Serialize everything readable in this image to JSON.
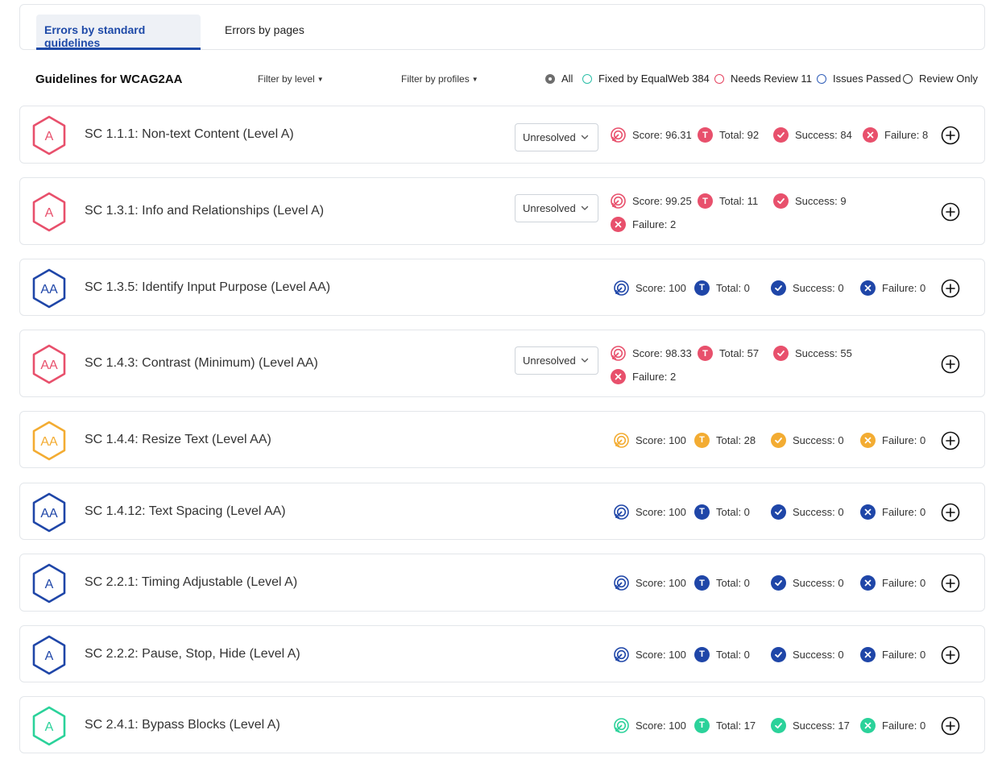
{
  "tabs": [
    {
      "label": "Errors by standard guidelines",
      "active": true
    },
    {
      "label": "Errors by pages",
      "active": false
    }
  ],
  "toolbar": {
    "title": "Guidelines for WCAG2AA",
    "filter_level": "Filter by level",
    "filter_profiles": "Filter by profiles",
    "radios": [
      {
        "label": "All",
        "selected": true,
        "color": "#555555"
      },
      {
        "label": "Fixed by EqualWeb 384",
        "selected": false,
        "color": "#2bbfa8"
      },
      {
        "label": "Needs Review 11",
        "selected": false,
        "color": "#e5425f"
      },
      {
        "label": "Issues Passed",
        "selected": false,
        "color": "#2f5db8"
      },
      {
        "label": "Review Only",
        "selected": false,
        "color": "#333333"
      }
    ]
  },
  "colors": {
    "red": "#e8506c",
    "blue": "#1f46a8",
    "orange": "#f3ac32",
    "green": "#2bd29a"
  },
  "guidelines": [
    {
      "level_badge": "A",
      "color": "red",
      "title": "SC 1.1.1: Non-text Content (Level A)",
      "status": "Unresolved",
      "score": "Score: 96.31",
      "total": "Total: 92",
      "success": "Success: 84",
      "failure": "Failure: 8"
    },
    {
      "level_badge": "A",
      "color": "red",
      "title": "SC 1.3.1: Info and Relationships (Level A)",
      "status": "Unresolved",
      "score": "Score: 99.25",
      "total": "Total: 11",
      "success": "Success: 9",
      "failure": "Failure: 2"
    },
    {
      "level_badge": "AA",
      "color": "blue",
      "title": "SC 1.3.5: Identify Input Purpose (Level AA)",
      "status": null,
      "score": "Score: 100",
      "total": "Total: 0",
      "success": "Success: 0",
      "failure": "Failure: 0"
    },
    {
      "level_badge": "AA",
      "color": "red",
      "title": "SC 1.4.3: Contrast (Minimum) (Level AA)",
      "status": "Unresolved",
      "score": "Score: 98.33",
      "total": "Total: 57",
      "success": "Success: 55",
      "failure": "Failure: 2"
    },
    {
      "level_badge": "AA",
      "color": "orange",
      "title": "SC 1.4.4: Resize Text (Level AA)",
      "status": null,
      "score": "Score: 100",
      "total": "Total: 28",
      "success": "Success: 0",
      "failure": "Failure: 0"
    },
    {
      "level_badge": "AA",
      "color": "blue",
      "title": "SC 1.4.12: Text Spacing (Level AA)",
      "status": null,
      "score": "Score: 100",
      "total": "Total: 0",
      "success": "Success: 0",
      "failure": "Failure: 0"
    },
    {
      "level_badge": "A",
      "color": "blue",
      "title": "SC 2.2.1: Timing Adjustable (Level A)",
      "status": null,
      "score": "Score: 100",
      "total": "Total: 0",
      "success": "Success: 0",
      "failure": "Failure: 0"
    },
    {
      "level_badge": "A",
      "color": "blue",
      "title": "SC 2.2.2: Pause, Stop, Hide (Level A)",
      "status": null,
      "score": "Score: 100",
      "total": "Total: 0",
      "success": "Success: 0",
      "failure": "Failure: 0"
    },
    {
      "level_badge": "A",
      "color": "green",
      "title": "SC 2.4.1: Bypass Blocks (Level A)",
      "status": null,
      "score": "Score: 100",
      "total": "Total: 17",
      "success": "Success: 17",
      "failure": "Failure: 0"
    }
  ]
}
